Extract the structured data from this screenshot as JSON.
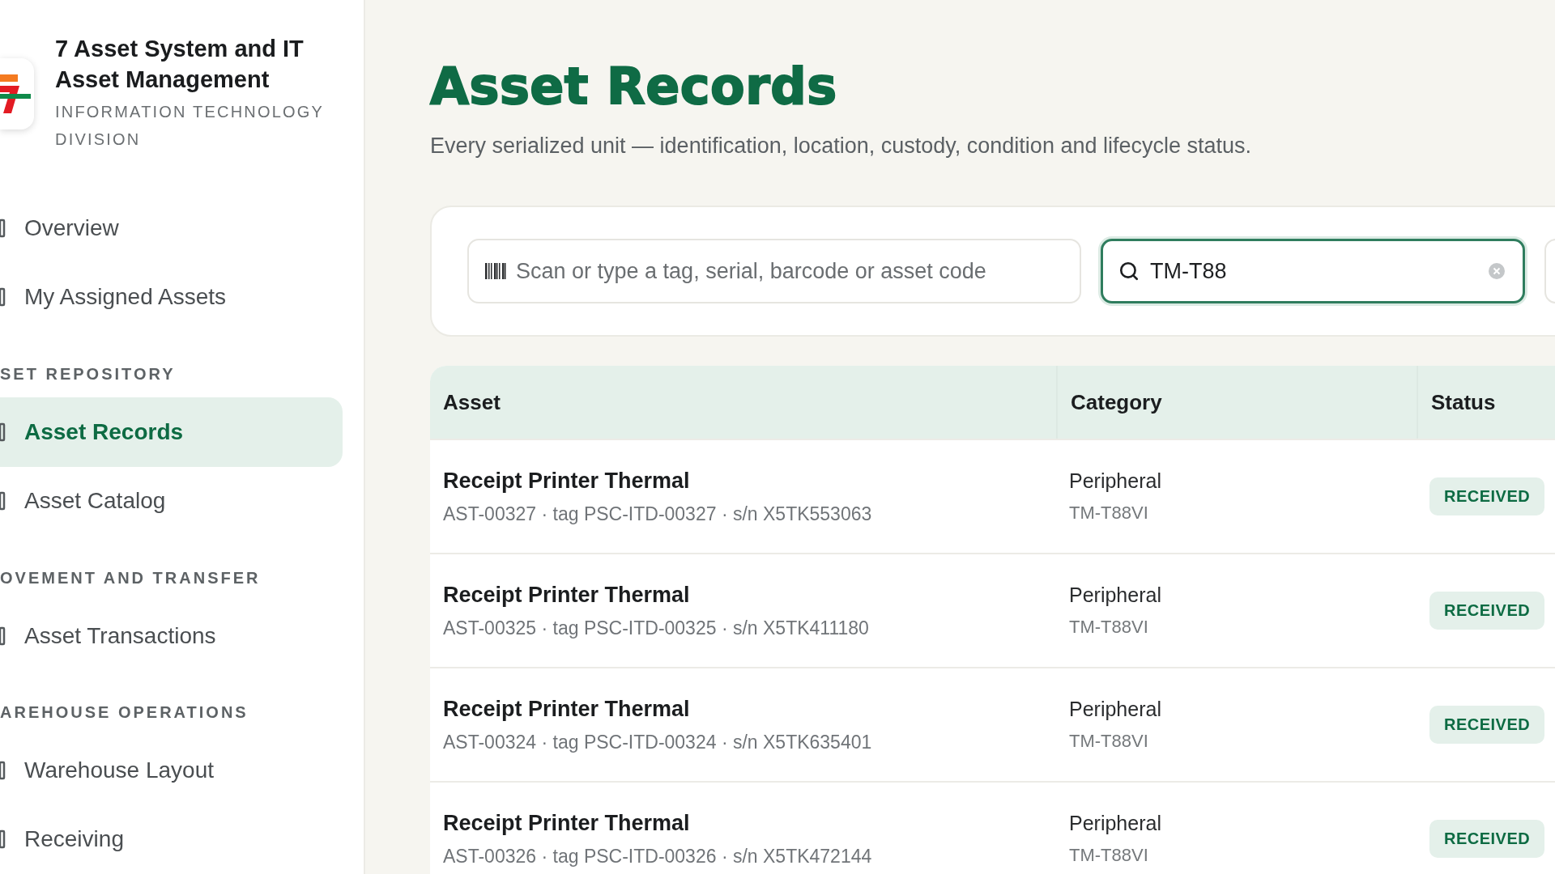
{
  "sidebar": {
    "title": "7 Asset System and IT Asset Management",
    "subtitle": "INFORMATION TECHNOLOGY DIVISION",
    "items": [
      {
        "kind": "link",
        "label": "Overview",
        "selected": false
      },
      {
        "kind": "link",
        "label": "My Assigned Assets",
        "selected": false
      },
      {
        "kind": "section",
        "label": "SET REPOSITORY"
      },
      {
        "kind": "link",
        "label": "Asset Records",
        "selected": true
      },
      {
        "kind": "link",
        "label": "Asset Catalog",
        "selected": false
      },
      {
        "kind": "section",
        "label": "OVEMENT AND TRANSFER"
      },
      {
        "kind": "link",
        "label": "Asset Transactions",
        "selected": false
      },
      {
        "kind": "section",
        "label": "AREHOUSE OPERATIONS"
      },
      {
        "kind": "link",
        "label": "Warehouse Layout",
        "selected": false
      },
      {
        "kind": "link",
        "label": "Receiving",
        "selected": false
      }
    ]
  },
  "page": {
    "title": "Asset Records",
    "subtitle": "Every serialized unit — identification, location, custody, condition and lifecycle status."
  },
  "filters": {
    "scan": {
      "placeholder": "Scan or type a tag, serial, barcode or asset code"
    },
    "search": {
      "value": "TM-T88",
      "focused": true
    }
  },
  "table": {
    "columns": [
      "Asset",
      "Category",
      "Status"
    ],
    "rows": [
      {
        "name": "Receipt Printer Thermal",
        "details": "AST-00327 · tag PSC-ITD-00327 · s/n X5TK553063",
        "category": "Peripheral",
        "model": "TM-T88VI",
        "status": "RECEIVED"
      },
      {
        "name": "Receipt Printer Thermal",
        "details": "AST-00325 · tag PSC-ITD-00325 · s/n X5TK411180",
        "category": "Peripheral",
        "model": "TM-T88VI",
        "status": "RECEIVED"
      },
      {
        "name": "Receipt Printer Thermal",
        "details": "AST-00324 · tag PSC-ITD-00324 · s/n X5TK635401",
        "category": "Peripheral",
        "model": "TM-T88VI",
        "status": "RECEIVED"
      },
      {
        "name": "Receipt Printer Thermal",
        "details": "AST-00326 · tag PSC-ITD-00326 · s/n X5TK472144",
        "category": "Peripheral",
        "model": "TM-T88VI",
        "status": "RECEIVED"
      }
    ]
  }
}
